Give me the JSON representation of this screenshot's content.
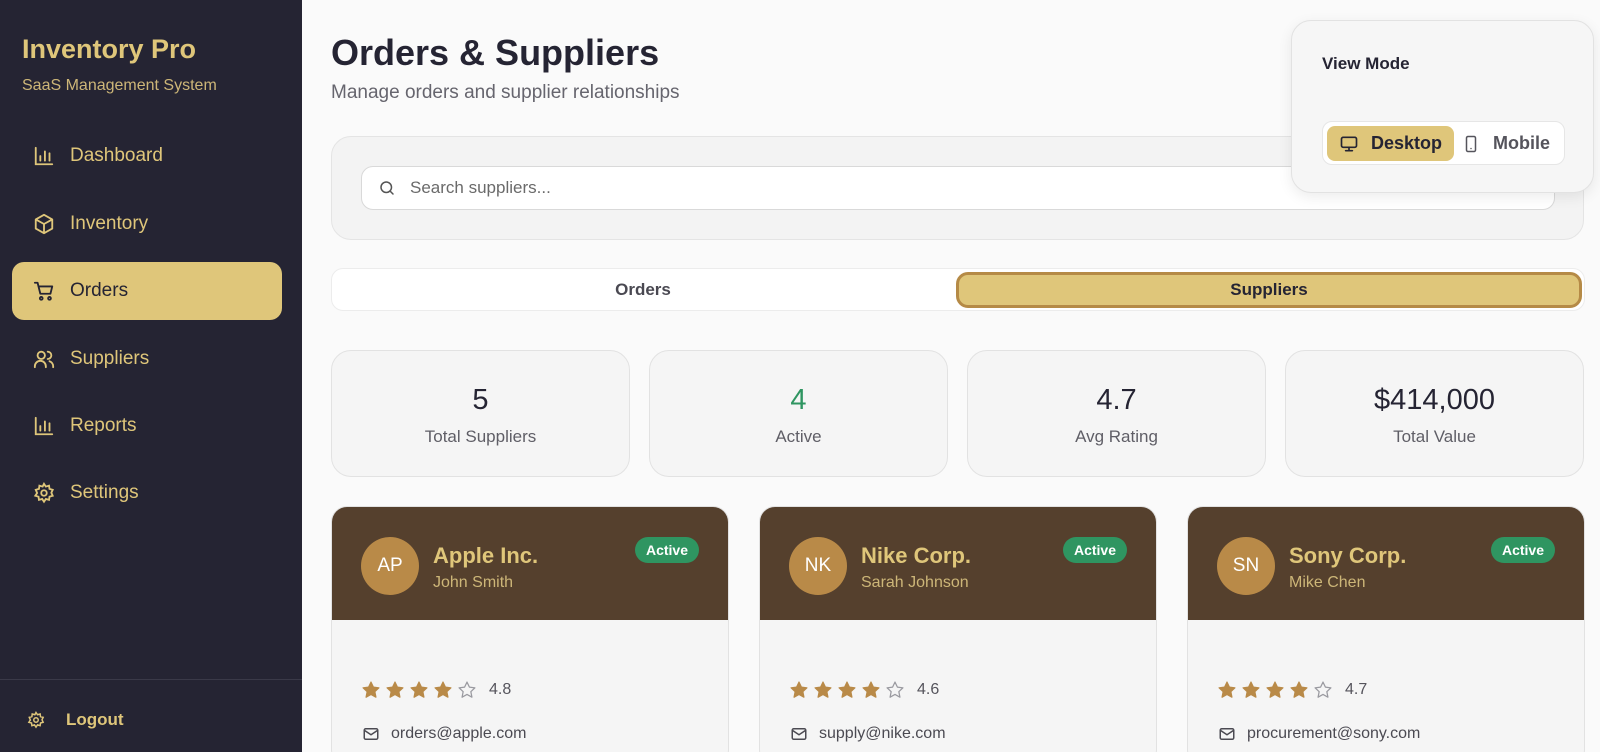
{
  "app": {
    "title": "Inventory Pro",
    "subtitle": "SaaS Management System"
  },
  "sidebar": {
    "items": [
      {
        "label": "Dashboard",
        "icon": "bar-chart-icon"
      },
      {
        "label": "Inventory",
        "icon": "box-icon"
      },
      {
        "label": "Orders",
        "icon": "cart-icon",
        "active": true
      },
      {
        "label": "Suppliers",
        "icon": "users-icon"
      },
      {
        "label": "Reports",
        "icon": "bar-chart-icon"
      },
      {
        "label": "Settings",
        "icon": "gear-icon"
      }
    ],
    "logout_label": "Logout"
  },
  "header": {
    "title": "Orders & Suppliers",
    "subtitle": "Manage orders and supplier relationships"
  },
  "search": {
    "placeholder": "Search suppliers..."
  },
  "view_mode": {
    "title": "View Mode",
    "desktop_label": "Desktop",
    "mobile_label": "Mobile",
    "selected": "Desktop"
  },
  "tabs": [
    {
      "label": "Orders"
    },
    {
      "label": "Suppliers",
      "active": true
    }
  ],
  "stats": [
    {
      "value": "5",
      "label": "Total Suppliers"
    },
    {
      "value": "4",
      "label": "Active"
    },
    {
      "value": "4.7",
      "label": "Avg Rating"
    },
    {
      "value": "$414,000",
      "label": "Total Value"
    }
  ],
  "suppliers": [
    {
      "initials": "AP",
      "name": "Apple Inc.",
      "contact": "John Smith",
      "status": "Active",
      "rating": "4.8",
      "stars_filled": 4,
      "email": "orders@apple.com"
    },
    {
      "initials": "NK",
      "name": "Nike Corp.",
      "contact": "Sarah Johnson",
      "status": "Active",
      "rating": "4.6",
      "stars_filled": 4,
      "email": "supply@nike.com"
    },
    {
      "initials": "SN",
      "name": "Sony Corp.",
      "contact": "Mike Chen",
      "status": "Active",
      "rating": "4.7",
      "stars_filled": 4,
      "email": "procurement@sony.com"
    }
  ],
  "colors": {
    "sidebar_bg": "#252433",
    "accent": "#dfc67a",
    "card_header": "#55402d",
    "active_badge": "#2f9561",
    "active_stat": "#2f9561",
    "star": "#b98a48"
  }
}
